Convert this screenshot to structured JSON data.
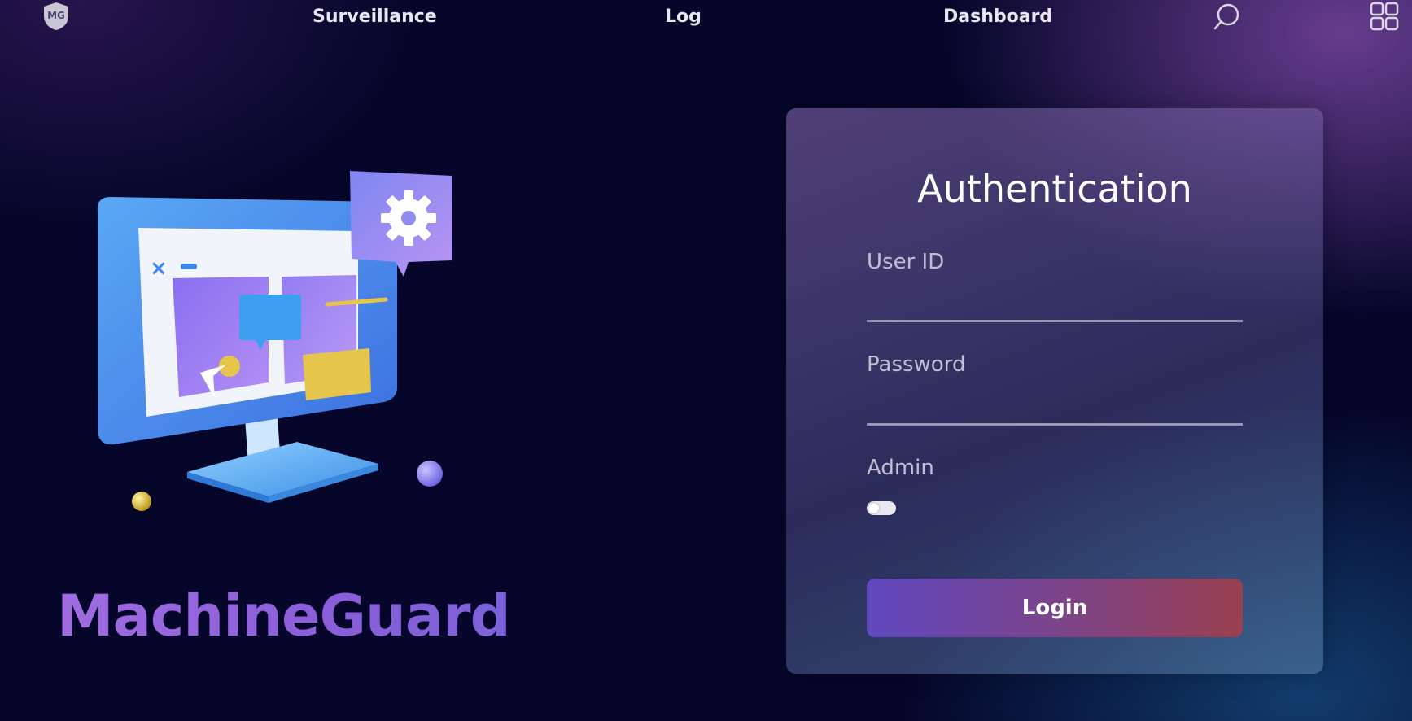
{
  "nav": {
    "logo_text": "MG",
    "links": [
      "Surveillance",
      "Log",
      "Dashboard"
    ],
    "icons": [
      "search-icon",
      "grid-menu-icon"
    ]
  },
  "brand": {
    "name": "MachineGuard"
  },
  "auth": {
    "title": "Authentication",
    "user_id_label": "User ID",
    "user_id_value": "",
    "password_label": "Password",
    "password_value": "",
    "admin_label": "Admin",
    "admin_enabled": false,
    "login_label": "Login"
  },
  "colors": {
    "background": "#05062a",
    "brand_gradient_start": "#a06ce0",
    "brand_gradient_end": "#7b62d8",
    "button_gradient_start": "#6048c0",
    "button_gradient_end": "#9a4050",
    "underline": "#9a96b6"
  }
}
